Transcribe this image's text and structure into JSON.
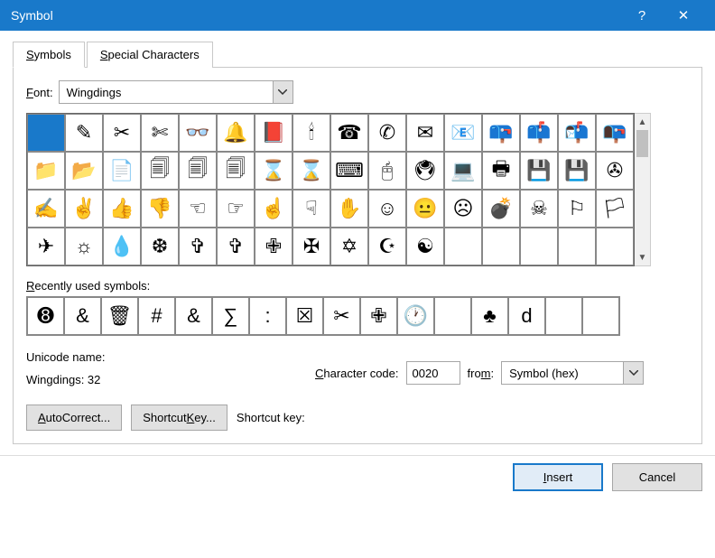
{
  "titlebar": {
    "title": "Symbol",
    "help": "?",
    "close": "✕"
  },
  "tabs": {
    "symbols": "Symbols",
    "special": "Special Characters"
  },
  "font": {
    "label": "Font:",
    "value": "Wingdings"
  },
  "grid": {
    "cells": [
      "",
      "✎",
      "✂",
      "✄",
      "👓",
      "🔔",
      "📕",
      "🕯",
      "☎",
      "✆",
      "✉",
      "📧",
      "📪",
      "📫",
      "📬",
      "📭",
      "📁",
      "📂",
      "📄",
      "🗐",
      "🗐",
      "🗐",
      "⌛",
      "⌛",
      "⌨",
      "🖰",
      "🖲",
      "💻",
      "🖶",
      "💾",
      "💾",
      "✇",
      "✍",
      "✌",
      "👍",
      "👎",
      "☜",
      "☞",
      "☝",
      "☟",
      "✋",
      "☺",
      "😐",
      "☹",
      "💣",
      "☠",
      "⚐",
      "🏳",
      "✈",
      "☼",
      "💧",
      "❆",
      "✞",
      "✞",
      "✙",
      "✠",
      "✡",
      "☪",
      "☯"
    ]
  },
  "recent": {
    "label": "Recently used symbols:",
    "cells": [
      "➑",
      "&",
      "🗑",
      "#",
      "&",
      "∑",
      ":",
      "☒",
      "✂",
      "✙",
      "🕐",
      "",
      "♣",
      "d",
      "",
      ""
    ]
  },
  "info": {
    "unicode_name_label": "Unicode name:",
    "wingdings_label": "Wingdings: 32",
    "char_code_label": "Character code:",
    "char_code": "0020",
    "from_label": "from:",
    "from_value": "Symbol (hex)"
  },
  "bottom": {
    "autocorrect": "AutoCorrect...",
    "shortcut_key": "Shortcut Key...",
    "shortcut_label": "Shortcut key:"
  },
  "footer": {
    "insert": "Insert",
    "cancel": "Cancel"
  }
}
